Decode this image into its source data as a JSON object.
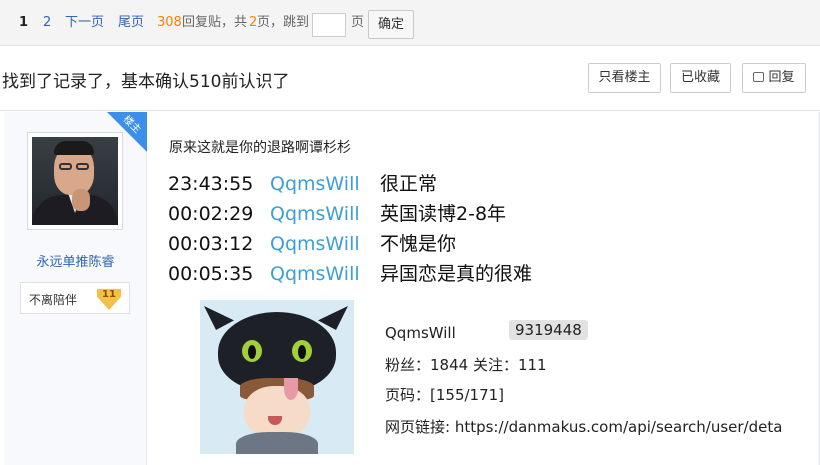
{
  "pager": {
    "current_page": "1",
    "page_2": "2",
    "next_page": "下一页",
    "last_page": "尾页",
    "reply_count": "308",
    "replies_text": "回复贴，共",
    "total_pages": "2",
    "pages_suffix": "页，",
    "goto_label": "跳到",
    "goto_input_value": "",
    "page_suffix": "页",
    "confirm_label": "确定"
  },
  "thread": {
    "title": "找到了记录了，基本确认510前认识了",
    "only_op_label": "只看楼主",
    "collected_label": "已收藏",
    "reply_label": "回复"
  },
  "author": {
    "name": "永远单推陈睿",
    "badge_label": "不离陪伴",
    "badge_level": "11",
    "op_tag": "楼主"
  },
  "post": {
    "text": "原来这就是你的退路啊谭杉杉",
    "chat": [
      {
        "time": "23:43:55",
        "user": "QqmsWill",
        "message": "很正常"
      },
      {
        "time": "00:02:29",
        "user": "QqmsWill",
        "message": "英国读博2-8年"
      },
      {
        "time": "00:03:12",
        "user": "QqmsWill",
        "message": "不愧是你"
      },
      {
        "time": "00:05:35",
        "user": "QqmsWill",
        "message": "异国恋是真的很难"
      }
    ],
    "profile": {
      "name": "QqmsWill",
      "uid": "9319448",
      "fans_line": "粉丝：1844   关注：111",
      "page_line": "页码：[155/171]",
      "link_line": "网页链接: https://danmakus.com/api/search/user/deta"
    }
  },
  "colors": {
    "link_blue": "#2d64b3",
    "orange": "#ff7f00",
    "chat_user": "#3d9fd6",
    "op_tag": "#3b8fe8"
  }
}
